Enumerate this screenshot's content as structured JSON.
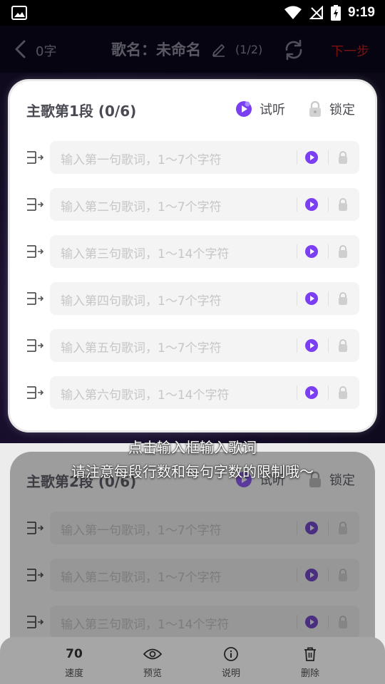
{
  "status_bar": {
    "time": "9:19",
    "icons": [
      "image-icon",
      "wifi-icon",
      "no-signal-icon",
      "battery-charging-icon"
    ]
  },
  "header": {
    "char_count": "0字",
    "title": "歌名：未命名",
    "page_indicator": "(1/2)",
    "next_label": "下一步"
  },
  "sections": [
    {
      "title": "主歌第1段 (0/6)",
      "listen_label": "试听",
      "lock_label": "锁定",
      "lines": [
        {
          "placeholder": "输入第一句歌词，1〜7个字符"
        },
        {
          "placeholder": "输入第二句歌词，1〜7个字符"
        },
        {
          "placeholder": "输入第三句歌词，1〜14个字符"
        },
        {
          "placeholder": "输入第四句歌词，1〜7个字符"
        },
        {
          "placeholder": "输入第五句歌词，1〜7个字符"
        },
        {
          "placeholder": "输入第六句歌词，1〜14个字符"
        }
      ]
    },
    {
      "title": "主歌第2段 (0/6)",
      "listen_label": "试听",
      "lock_label": "锁定",
      "lines": [
        {
          "placeholder": "输入第一句歌词，1〜7个字符"
        },
        {
          "placeholder": "输入第二句歌词，1〜7个字符"
        },
        {
          "placeholder": "输入第三句歌词，1〜14个字符"
        }
      ]
    }
  ],
  "guide": {
    "line1": "点击输入框输入歌词",
    "line2": "请注意每段行数和每句字数的限制哦〜"
  },
  "toolbar": {
    "speed_value": "70",
    "speed_label": "速度",
    "preview_label": "预览",
    "help_label": "说明",
    "delete_label": "删除"
  },
  "colors": {
    "accent": "#7b3ff2",
    "next": "#7a1212"
  }
}
